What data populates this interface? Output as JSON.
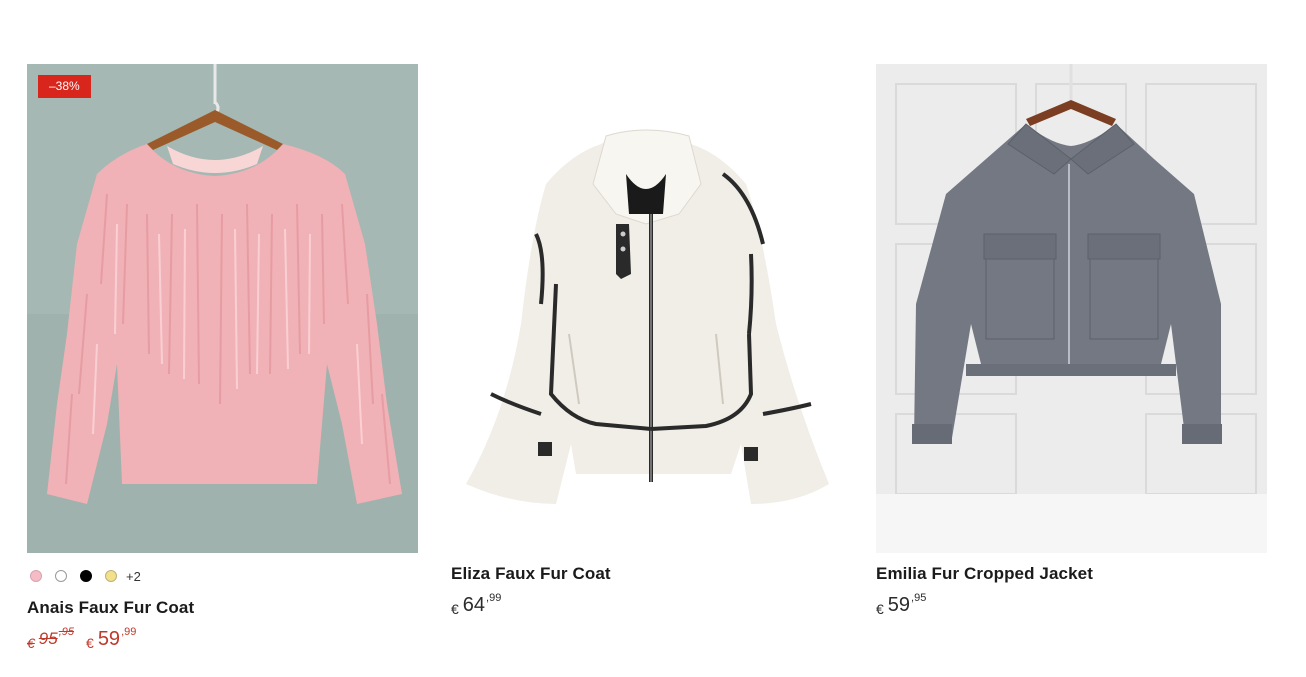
{
  "products": [
    {
      "badge": "–38%",
      "name": "Anais Faux Fur Coat",
      "swatches": [
        "pink",
        "white",
        "black",
        "yellow"
      ],
      "more_colors": "+2",
      "old_price": {
        "currency": "€",
        "int": "95",
        "dec": ",95"
      },
      "price": {
        "currency": "€",
        "int": "59",
        "dec": ",99"
      },
      "image_colors": {
        "background": "#9fb2ad",
        "coat": "#f0b2b6"
      }
    },
    {
      "name": "Eliza Faux Fur Coat",
      "price": {
        "currency": "€",
        "int": "64",
        "dec": ",99"
      },
      "image_colors": {
        "background": "#ffffff",
        "coat": "#f1eee8",
        "trim": "#2a2a2a"
      }
    },
    {
      "name": "Emilia Fur Cropped Jacket",
      "price": {
        "currency": "€",
        "int": "59",
        "dec": ",95"
      },
      "image_colors": {
        "background": "#ececec",
        "coat": "#737883"
      }
    }
  ],
  "accent_color": "#d9261c"
}
